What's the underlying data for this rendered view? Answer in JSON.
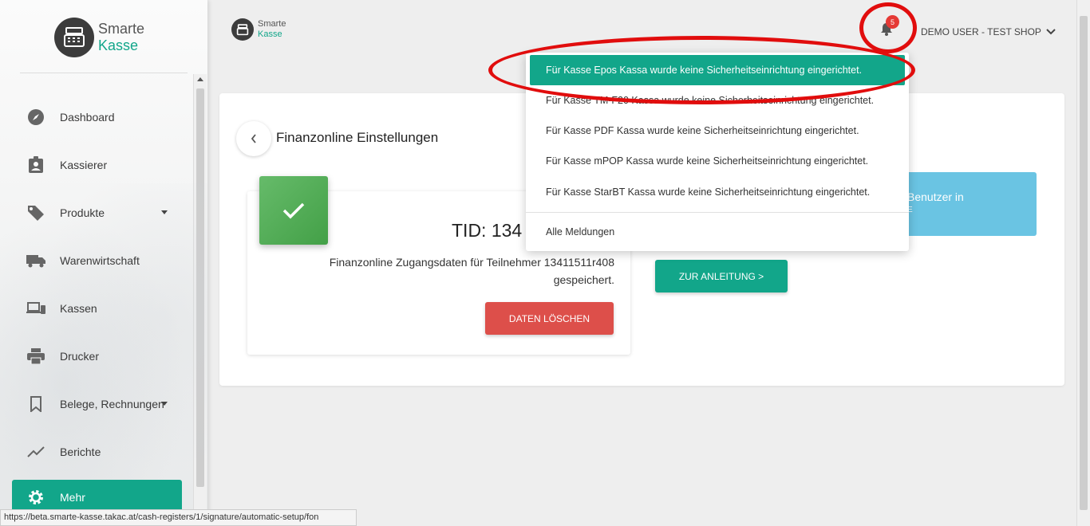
{
  "brand": {
    "line1": "Smarte",
    "line2": "Kasse"
  },
  "sidebar": {
    "items": [
      {
        "label": "Dashboard",
        "icon": "compass-icon"
      },
      {
        "label": "Kassierer",
        "icon": "badge-icon"
      },
      {
        "label": "Produkte",
        "icon": "tag-icon"
      },
      {
        "label": "Warenwirtschaft",
        "icon": "truck-icon"
      },
      {
        "label": "Kassen",
        "icon": "devices-icon"
      },
      {
        "label": "Drucker",
        "icon": "printer-icon"
      },
      {
        "label": "Belege, Rechnungen",
        "icon": "bookmark-icon"
      },
      {
        "label": "Berichte",
        "icon": "trend-icon"
      },
      {
        "label": "Mehr",
        "icon": "gear-icon"
      }
    ]
  },
  "topbar": {
    "notification_count": "5",
    "user": "DEMO USER - TEST SHOP"
  },
  "main": {
    "title": "Finanzonline Einstellungen",
    "tid": "TID: 134",
    "description": "Finanzonline Zugangsdaten für Teilnehmer 13411511r408 gespeichert.",
    "delete_button": "DATEN LÖSCHEN",
    "info_text": "Benutzer in",
    "info_subtext": "E",
    "guide_button": "ZUR ANLEITUNG >"
  },
  "notifications": {
    "items": [
      "Für Kasse Epos Kassa wurde keine Sicherheitseinrichtung eingerichtet.",
      "Für Kasse TM-F20 Kassa wurde keine Sicherheitseinrichtung eingerichtet.",
      "Für Kasse PDF Kassa wurde keine Sicherheitseinrichtung eingerichtet.",
      "Für Kasse mPOP Kassa wurde keine Sicherheitseinrichtung eingerichtet.",
      "Für Kasse StarBT Kassa wurde keine Sicherheitseinrichtung eingerichtet."
    ],
    "all_label": "Alle Meldungen"
  },
  "statusbar": {
    "url": "https://beta.smarte-kasse.takac.at/cash-registers/1/signature/automatic-setup/fon"
  },
  "colors": {
    "accent": "#12a68a",
    "danger": "#dd4f4a",
    "info": "#6ac4e3",
    "annotation": "#e10d0d"
  }
}
